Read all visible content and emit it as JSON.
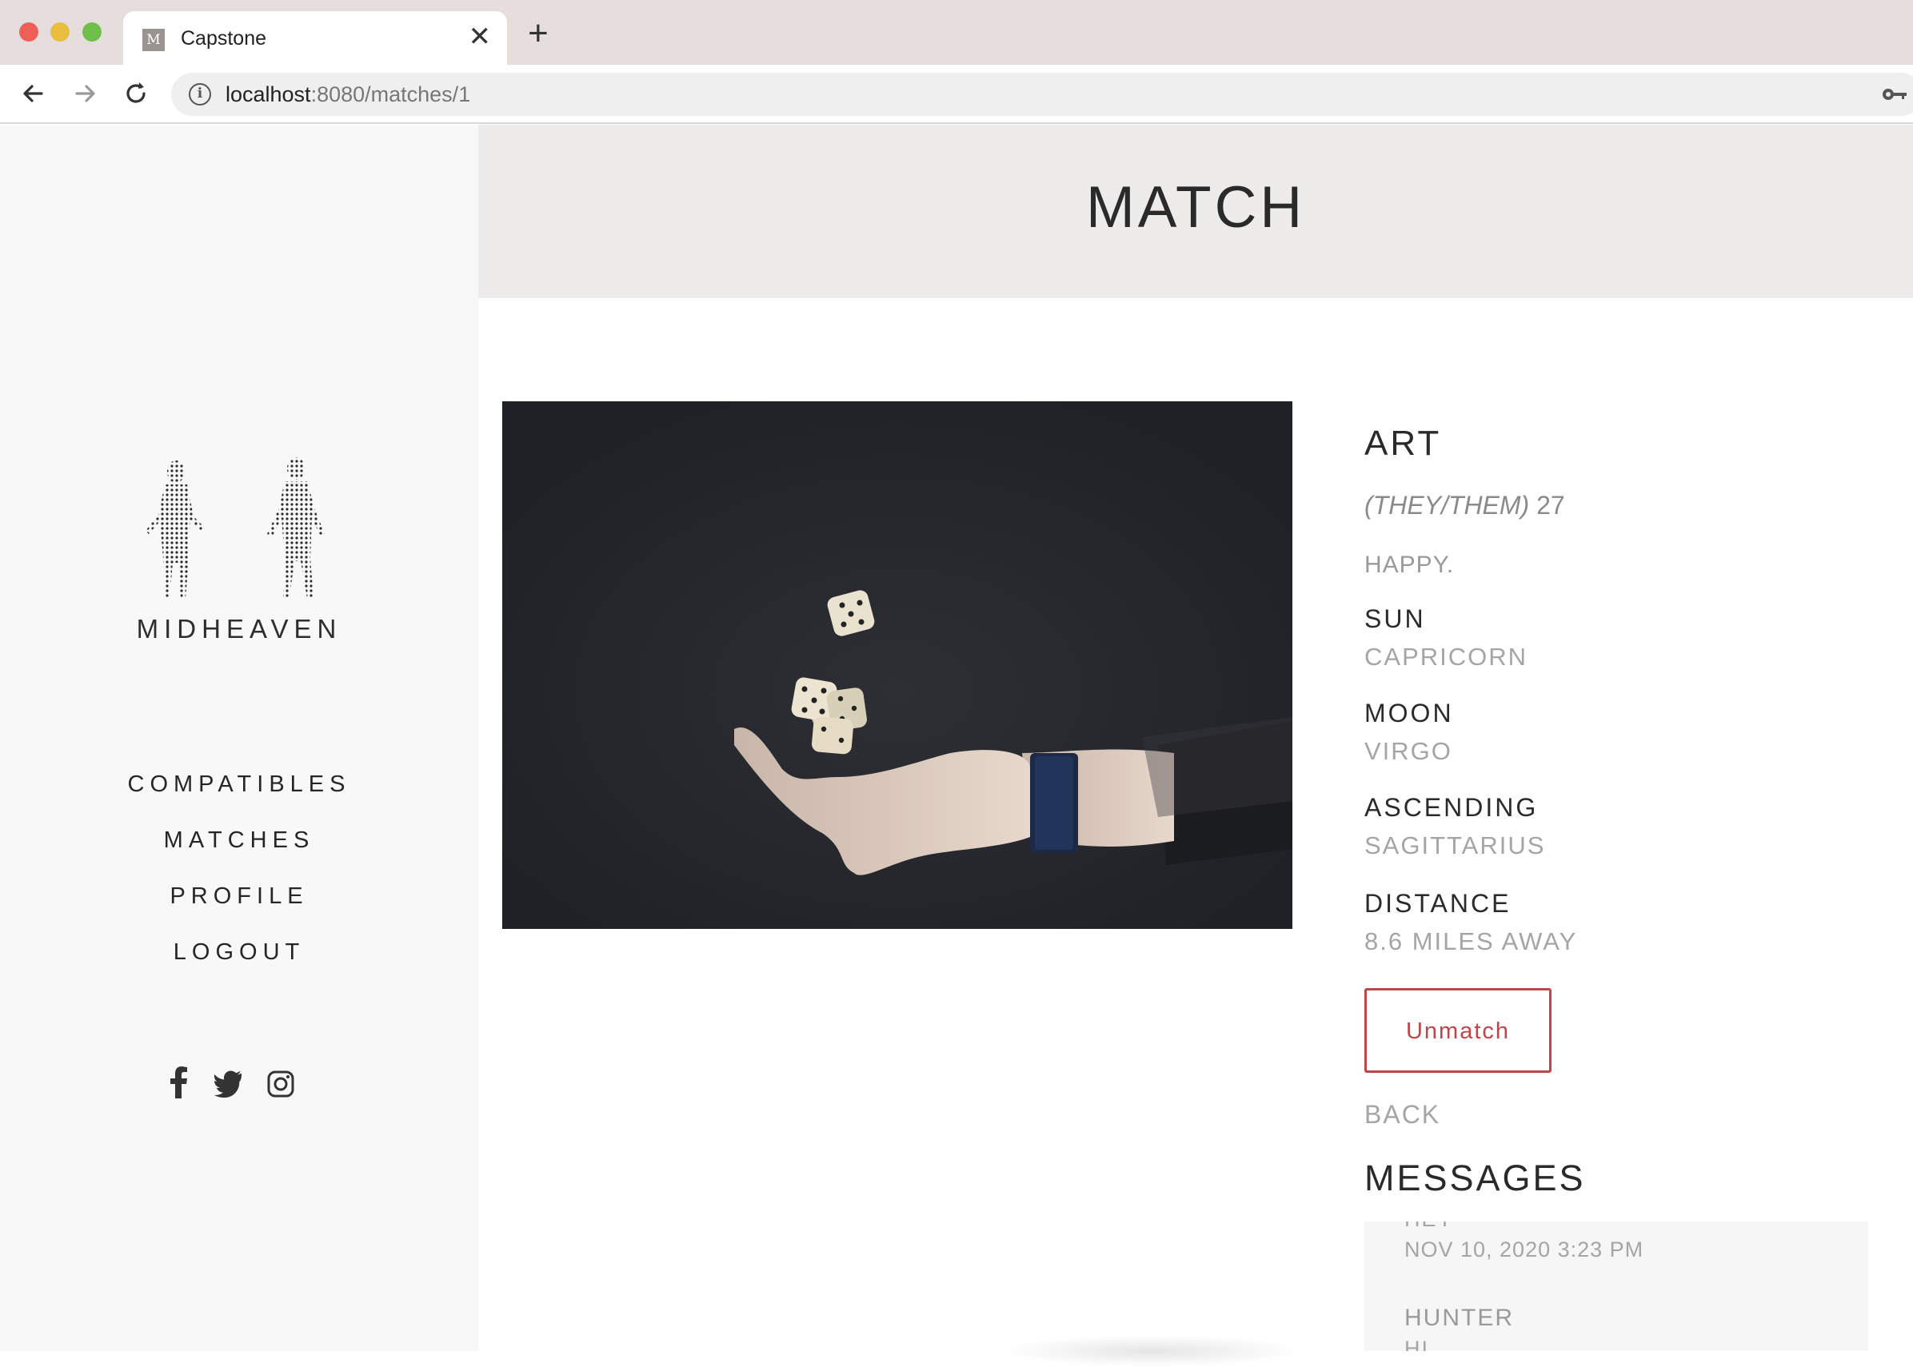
{
  "browser": {
    "tab_title": "Capstone",
    "tab_favicon_letter": "M",
    "tab_close": "✕",
    "new_tab": "+",
    "url_host": "localhost",
    "url_path": ":8080/matches/1",
    "icons": {
      "back": "arrow-left-icon",
      "forward": "arrow-right-icon",
      "reload": "reload-icon",
      "info": "info-icon",
      "key": "key-icon"
    }
  },
  "sidebar": {
    "logo_text": "MIDHEAVEN",
    "nav": [
      {
        "label": "COMPATIBLES"
      },
      {
        "label": "MATCHES"
      },
      {
        "label": "PROFILE"
      },
      {
        "label": "LOGOUT"
      }
    ],
    "social": [
      {
        "name": "facebook-icon",
        "glyph": "f"
      },
      {
        "name": "twitter-icon",
        "glyph": "🐦"
      },
      {
        "name": "instagram-icon",
        "glyph": "◎"
      }
    ]
  },
  "header": {
    "title": "MATCH"
  },
  "match": {
    "name": "ART",
    "pronouns": "(THEY/THEM)",
    "age": "27",
    "bio": "HAPPY.",
    "fields": {
      "sun": {
        "label": "SUN",
        "value": "CAPRICORN"
      },
      "moon": {
        "label": "MOON",
        "value": "VIRGO"
      },
      "ascending": {
        "label": "ASCENDING",
        "value": "SAGITTARIUS"
      },
      "distance": {
        "label": "DISTANCE",
        "value": "8.6 MILES AWAY"
      }
    },
    "unmatch_label": "Unmatch",
    "back_label": "BACK"
  },
  "messages": {
    "title": "MESSAGES",
    "items": [
      {
        "text": "HEY",
        "date": "NOV 10, 2020 3:23 PM"
      },
      {
        "author": "HUNTER",
        "text": "HI"
      }
    ]
  },
  "colors": {
    "accent_red": "#c0454a",
    "sidebar_bg": "#f8f8f8",
    "header_bg": "#edeceb",
    "photo_bg": "#25272c"
  }
}
